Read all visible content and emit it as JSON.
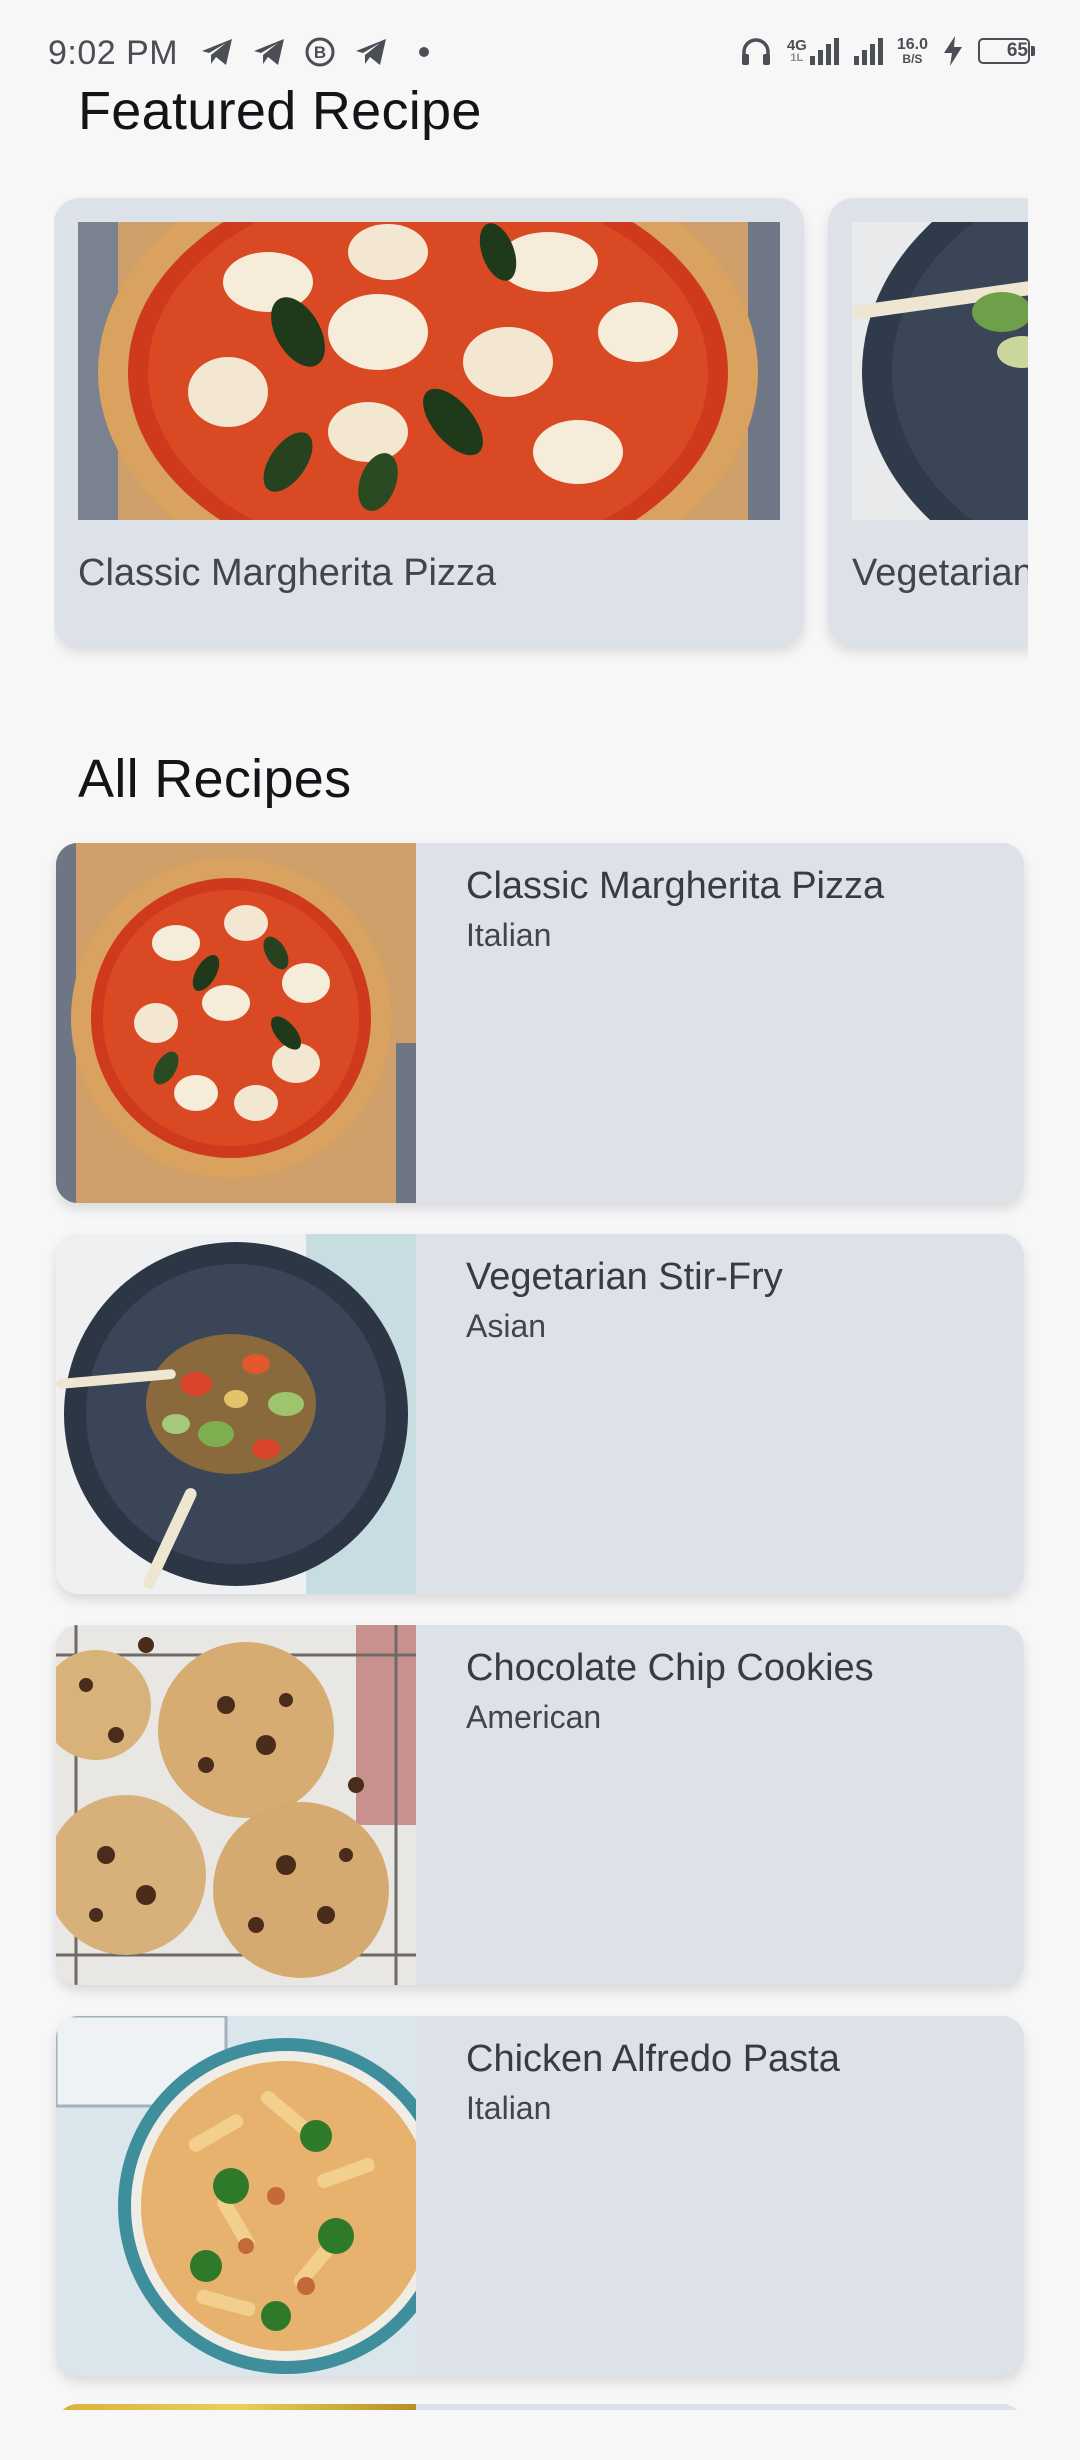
{
  "status_bar": {
    "time": "9:02 PM",
    "net_type_top": "4G",
    "net_type_bottom": "1L",
    "speed_value": "16.0",
    "speed_unit": "B/S",
    "battery": "65",
    "left_icons": [
      "telegram-icon",
      "telegram-icon",
      "bitcoin-icon",
      "telegram-icon",
      "dot-icon"
    ],
    "right_icons": [
      "headphones-icon",
      "signal-icon",
      "signal-icon",
      "charging-icon",
      "battery-icon"
    ]
  },
  "featured": {
    "title": "Featured Recipe",
    "cards": [
      {
        "name": "Classic Margherita Pizza",
        "image": "pizza"
      },
      {
        "name": "Vegetarian Stir-Fry",
        "image": "stir-fry"
      }
    ]
  },
  "all_recipes": {
    "title": "All Recipes",
    "items": [
      {
        "name": "Classic Margherita Pizza",
        "cuisine": "Italian",
        "image": "pizza"
      },
      {
        "name": "Vegetarian Stir-Fry",
        "cuisine": "Asian",
        "image": "stir-fry"
      },
      {
        "name": "Chocolate Chip Cookies",
        "cuisine": "American",
        "image": "cookies"
      },
      {
        "name": "Chicken Alfredo Pasta",
        "cuisine": "Italian",
        "image": "pasta"
      }
    ]
  },
  "colors": {
    "background": "#f7f7f8",
    "card": "#dde1e8",
    "title_text": "#121418",
    "body_text": "#41454c"
  }
}
